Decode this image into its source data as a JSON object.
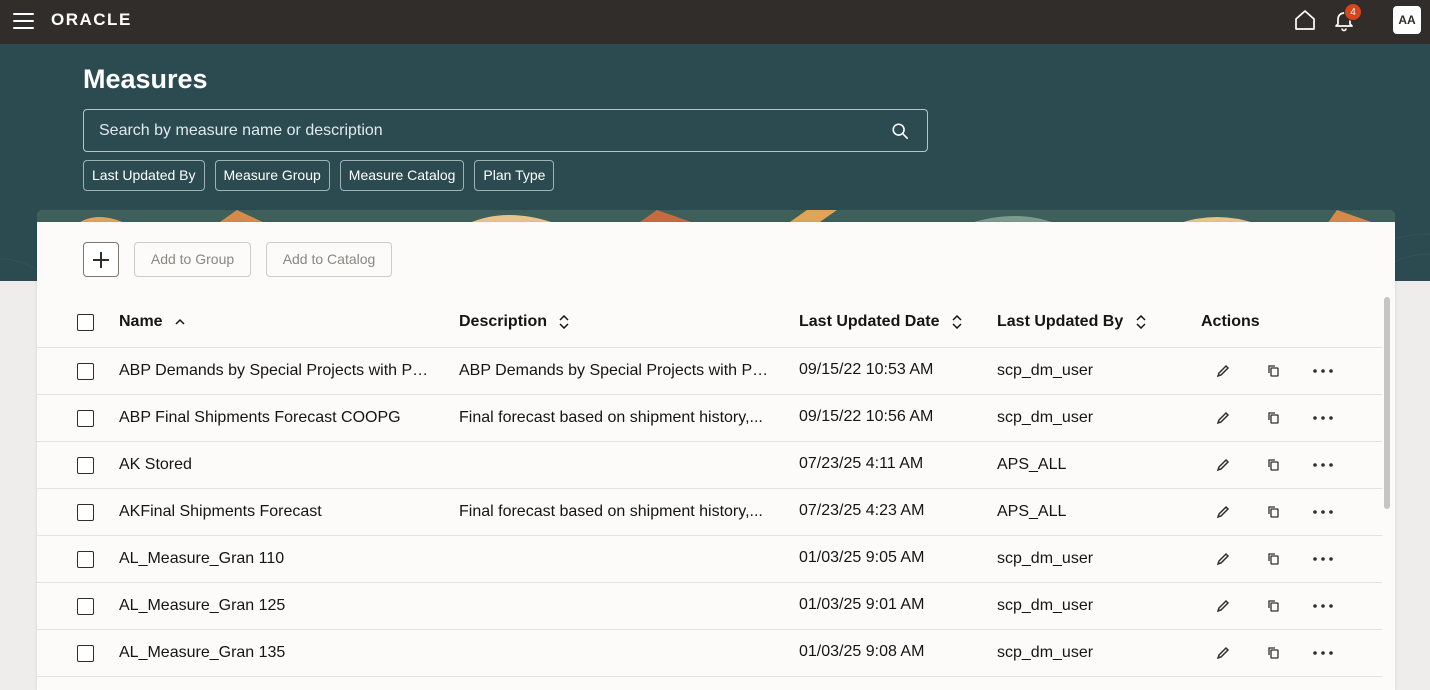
{
  "topbar": {
    "brand": "ORACLE",
    "notification_count": "4",
    "avatar_initials": "AA"
  },
  "header": {
    "title": "Measures",
    "search_placeholder": "Search by measure name or description",
    "filters": [
      "Last Updated By",
      "Measure Group",
      "Measure Catalog",
      "Plan Type"
    ]
  },
  "toolbar": {
    "add_to_group": "Add to Group",
    "add_to_catalog": "Add to Catalog"
  },
  "table": {
    "columns": {
      "name": "Name",
      "description": "Description",
      "last_updated_date": "Last Updated Date",
      "last_updated_by": "Last Updated By",
      "actions": "Actions"
    },
    "rows": [
      {
        "name": "ABP Demands by Special Projects with Pr...",
        "description": "ABP Demands by Special Projects with Pr...",
        "date": "09/15/22 10:53 AM",
        "user": "scp_dm_user"
      },
      {
        "name": "ABP Final Shipments Forecast COOPG",
        "description": "Final forecast based on shipment history,...",
        "date": "09/15/22 10:56 AM",
        "user": "scp_dm_user"
      },
      {
        "name": "AK Stored",
        "description": "",
        "date": "07/23/25 4:11 AM",
        "user": "APS_ALL"
      },
      {
        "name": "AKFinal Shipments Forecast",
        "description": "Final forecast based on shipment history,...",
        "date": "07/23/25 4:23 AM",
        "user": "APS_ALL"
      },
      {
        "name": "AL_Measure_Gran 110",
        "description": "",
        "date": "01/03/25 9:05 AM",
        "user": "scp_dm_user"
      },
      {
        "name": "AL_Measure_Gran 125",
        "description": "",
        "date": "01/03/25 9:01 AM",
        "user": "scp_dm_user"
      },
      {
        "name": "AL_Measure_Gran 135",
        "description": "",
        "date": "01/03/25 9:08 AM",
        "user": "scp_dm_user"
      }
    ]
  },
  "colors": {
    "topbar": "#312d2a",
    "hero": "#2b4b51",
    "badge": "#d6451b"
  }
}
